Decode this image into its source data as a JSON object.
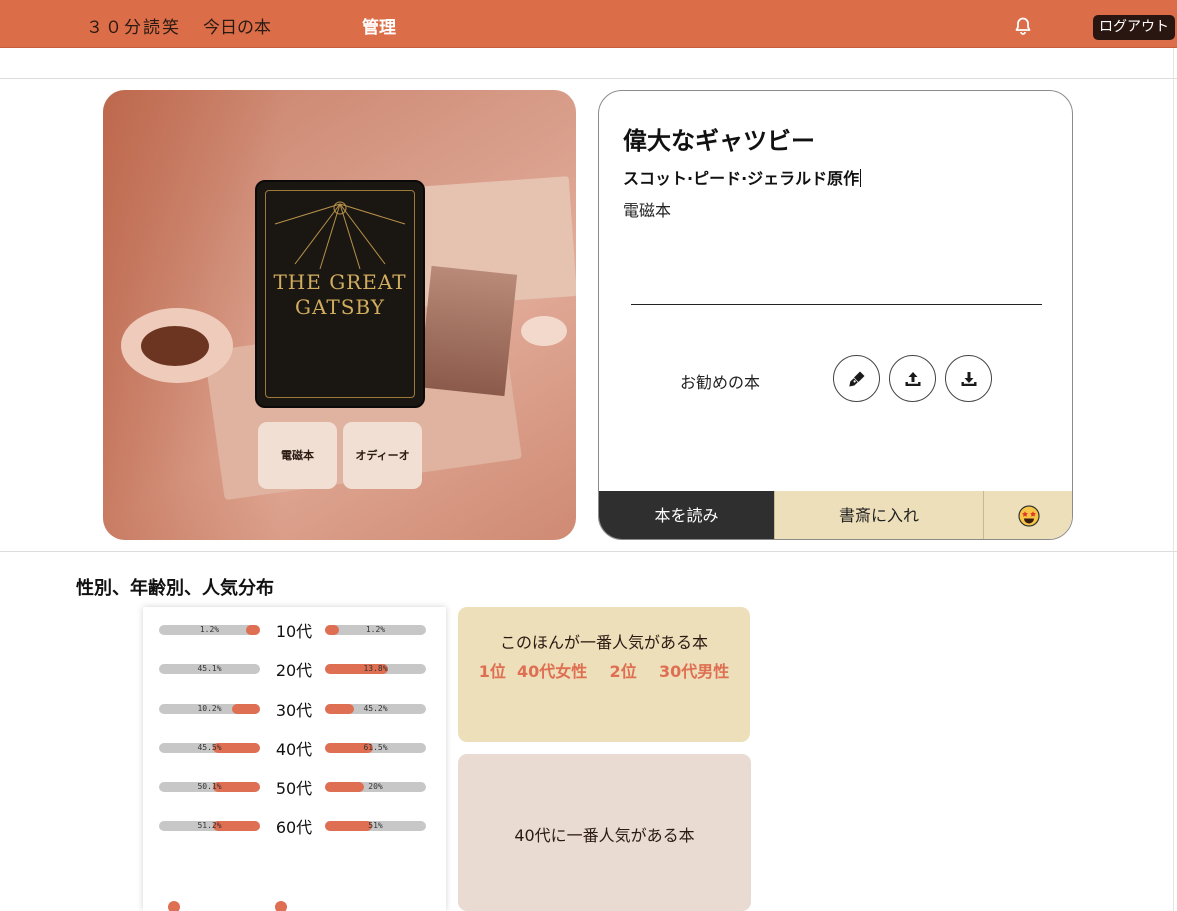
{
  "nav": {
    "brand": "３０分読笑",
    "today": "今日の本",
    "admin": "管理",
    "logout": "ログアウト"
  },
  "hero": {
    "cover_title": "THE GREAT GATSBY",
    "formats": [
      "電磁本",
      "オディーオ"
    ]
  },
  "book": {
    "title": "偉大なギャツビー",
    "author": "スコット·ピード·ジェラルド原作",
    "format": "電磁本",
    "recommend_label": "お勧めの本",
    "actions": {
      "read": "本を読み",
      "shelf": "書斎に入れ"
    }
  },
  "stats": {
    "title": "性別、年齢別、人気分布",
    "rows": [
      {
        "age": "10代",
        "left": "1.2%",
        "left_value": 0.14,
        "right": "1.2%",
        "right_value": 0.14
      },
      {
        "age": "20代",
        "left": "45.1%",
        "left_value": 0.0,
        "right": "13.8%",
        "right_value": 0.62
      },
      {
        "age": "30代",
        "left": "10.2%",
        "left_value": 0.28,
        "right": "45.2%",
        "right_value": 0.29
      },
      {
        "age": "40代",
        "left": "45.5%",
        "left_value": 0.47,
        "right": "61.5%",
        "right_value": 0.48
      },
      {
        "age": "50代",
        "left": "50.1%",
        "left_value": 0.47,
        "right": "20%",
        "right_value": 0.39
      },
      {
        "age": "60代",
        "left": "51.2%",
        "left_value": 0.47,
        "right": "51%",
        "right_value": 0.47
      }
    ],
    "popular_title": "このほんが一番人気がある本",
    "popular_rank": "1位  40代女性    2位    30代男性",
    "age_book_title": "40代に一番人気がある本"
  },
  "colors": {
    "accent": "#db6d48",
    "bar_fill": "#df6f52",
    "bar_track": "#c7c7c7",
    "cream": "#eddfba",
    "dark": "#2f2f2f"
  },
  "icons": [
    "bell-icon",
    "pen-icon",
    "upload-icon",
    "download-icon",
    "star-eyes-emoji-icon"
  ]
}
